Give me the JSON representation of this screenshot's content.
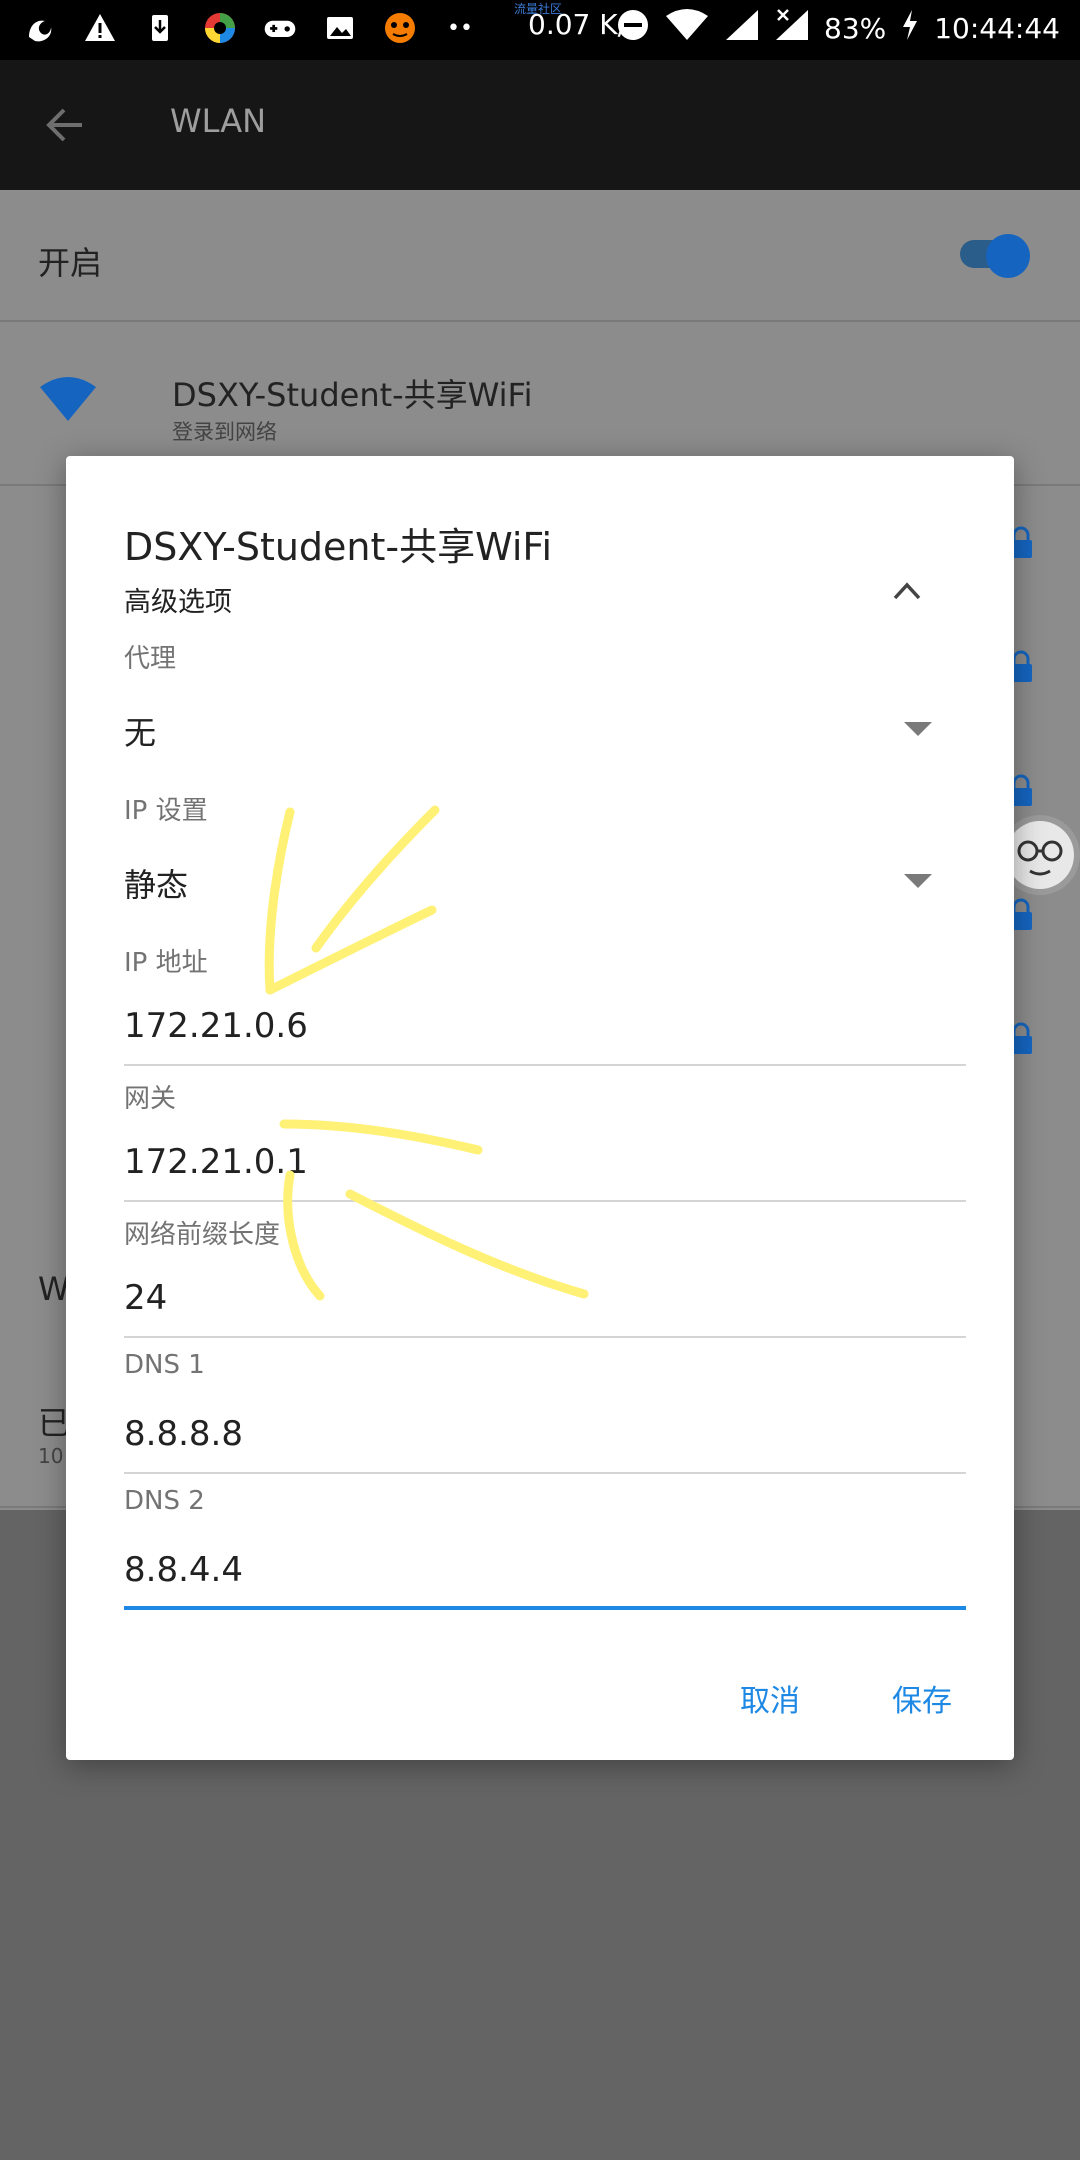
{
  "status_bar": {
    "carrier_tag": "流量社区",
    "speed": "0.07 K/s",
    "battery": "83%",
    "time": "10:44:44"
  },
  "appbar": {
    "title": "WLAN"
  },
  "background": {
    "toggle_label": "开启",
    "network_name": "DSXY-Student-共享WiFi",
    "network_status": "登录到网络",
    "partial_label_1": "W",
    "partial_label_2": "已",
    "partial_label_3": "10"
  },
  "dialog": {
    "title": "DSXY-Student-共享WiFi",
    "advanced_label": "高级选项",
    "proxy_label": "代理",
    "proxy_value": "无",
    "ip_settings_label": "IP 设置",
    "ip_settings_value": "静态",
    "ip_address_label": "IP 地址",
    "ip_address_value": "172.21.0.6",
    "gateway_label": "网关",
    "gateway_value": "172.21.0.1",
    "prefix_label": "网络前缀长度",
    "prefix_value": "24",
    "dns1_label": "DNS 1",
    "dns1_value": "8.8.8.8",
    "dns2_label": "DNS 2",
    "dns2_value": "8.8.4.4",
    "cancel_label": "取消",
    "save_label": "保存"
  },
  "colors": {
    "accent": "#1e88e5",
    "annotation": "#fff176",
    "scrim": "#8c8c8c"
  }
}
